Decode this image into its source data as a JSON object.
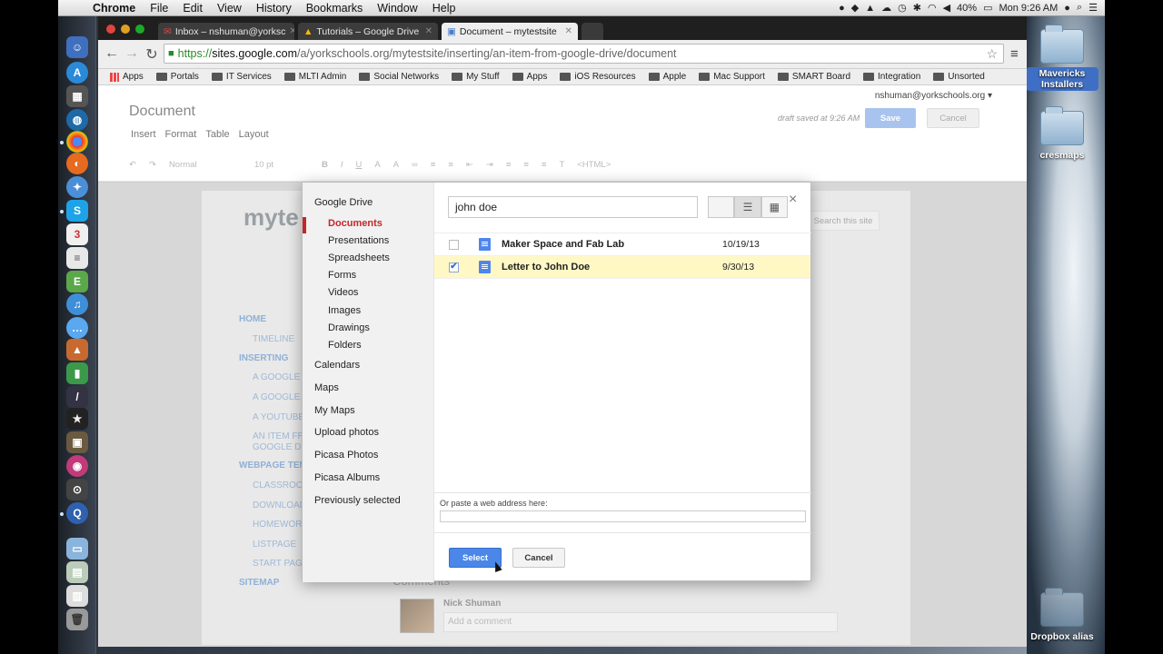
{
  "menubar": {
    "app": "Chrome",
    "items": [
      "File",
      "Edit",
      "View",
      "History",
      "Bookmarks",
      "Window",
      "Help"
    ],
    "battery": "40%",
    "clock": "Mon 9:26 AM"
  },
  "desktop": {
    "icons": [
      {
        "label": "Mavericks Installers"
      },
      {
        "label": "cresmaps"
      },
      {
        "label": "Dropbox alias"
      }
    ]
  },
  "tabs": [
    {
      "label": "Inbox – nshuman@yorksc"
    },
    {
      "label": "Tutorials – Google Drive"
    },
    {
      "label": "Document – mytestsite"
    }
  ],
  "omnibox": {
    "scheme": "https://",
    "host": "sites.google.com",
    "path": "/a/yorkschools.org/mytestsite/inserting/an-item-from-google-drive/document"
  },
  "bookmarks": [
    "Apps",
    "Portals",
    "IT Services",
    "MLTI Admin",
    "Social Networks",
    "My Stuff",
    "Apps",
    "iOS Resources",
    "Apple",
    "Mac Support",
    "SMART Board",
    "Integration",
    "Unsorted"
  ],
  "editor": {
    "user": "nshuman@yorkschools.org ▾",
    "title": "Document",
    "menu": [
      "Insert",
      "Format",
      "Table",
      "Layout"
    ],
    "draft_status": "draft saved at 9:26 AM",
    "save": "Save",
    "cancel": "Cancel",
    "style": "Normal",
    "size": "10 pt",
    "html": "<HTML>"
  },
  "site": {
    "name": "myte",
    "search": "Search this site",
    "nav": [
      "HOME",
      "TIMELINE",
      "INSERTING",
      "A GOOGLE C",
      "A GOOGLE F",
      "A YOUTUBE",
      "AN ITEM FR",
      "GOOGLE DR",
      "WEBPAGE TEM",
      "CLASSROO",
      "DOWNLOAD",
      "HOMEWORK",
      "LISTPAGE",
      "START PAGE",
      "SITEMAP"
    ],
    "comments_heading": "Comments",
    "commenter": "Nick Shuman",
    "comment_placeholder": "Add a comment"
  },
  "dialog": {
    "sources": {
      "drive": "Google Drive",
      "drive_sub": [
        "Documents",
        "Presentations",
        "Spreadsheets",
        "Forms",
        "Videos",
        "Images",
        "Drawings",
        "Folders"
      ],
      "others": [
        "Calendars",
        "Maps",
        "My Maps",
        "Upload photos",
        "Picasa Photos",
        "Picasa Albums",
        "Previously selected"
      ]
    },
    "search_value": "john doe",
    "files": [
      {
        "name": "Maker Space and Fab Lab",
        "date": "10/19/13",
        "checked": false
      },
      {
        "name": "Letter to John Doe",
        "date": "9/30/13",
        "checked": true
      }
    ],
    "paste_label": "Or paste a web address here:",
    "select": "Select",
    "cancel": "Cancel"
  }
}
